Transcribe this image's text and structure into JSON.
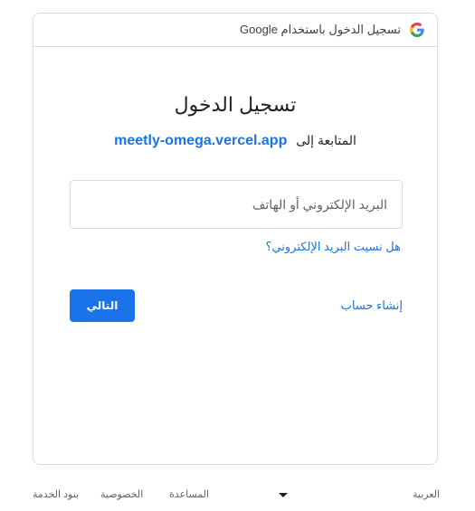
{
  "header": {
    "text": "تسجيل الدخول باستخدام Google",
    "logo_icon": "google-g-logo"
  },
  "main": {
    "title": "تسجيل الدخول",
    "subtitle_prefix": "المتابعة إلى",
    "app_name": "meetly-omega.vercel.app",
    "email_placeholder": "البريد الإلكتروني أو الهاتف",
    "forgot_email": "هل نسيت البريد الإلكتروني؟",
    "create_account": "إنشاء حساب",
    "next_button": "التالي"
  },
  "footer": {
    "language": "العربية",
    "help": "المساعدة",
    "privacy": "الخصوصية",
    "terms": "بنود الخدمة"
  },
  "colors": {
    "accent": "#1a73e8",
    "border": "#dadce0",
    "text": "#202124"
  }
}
